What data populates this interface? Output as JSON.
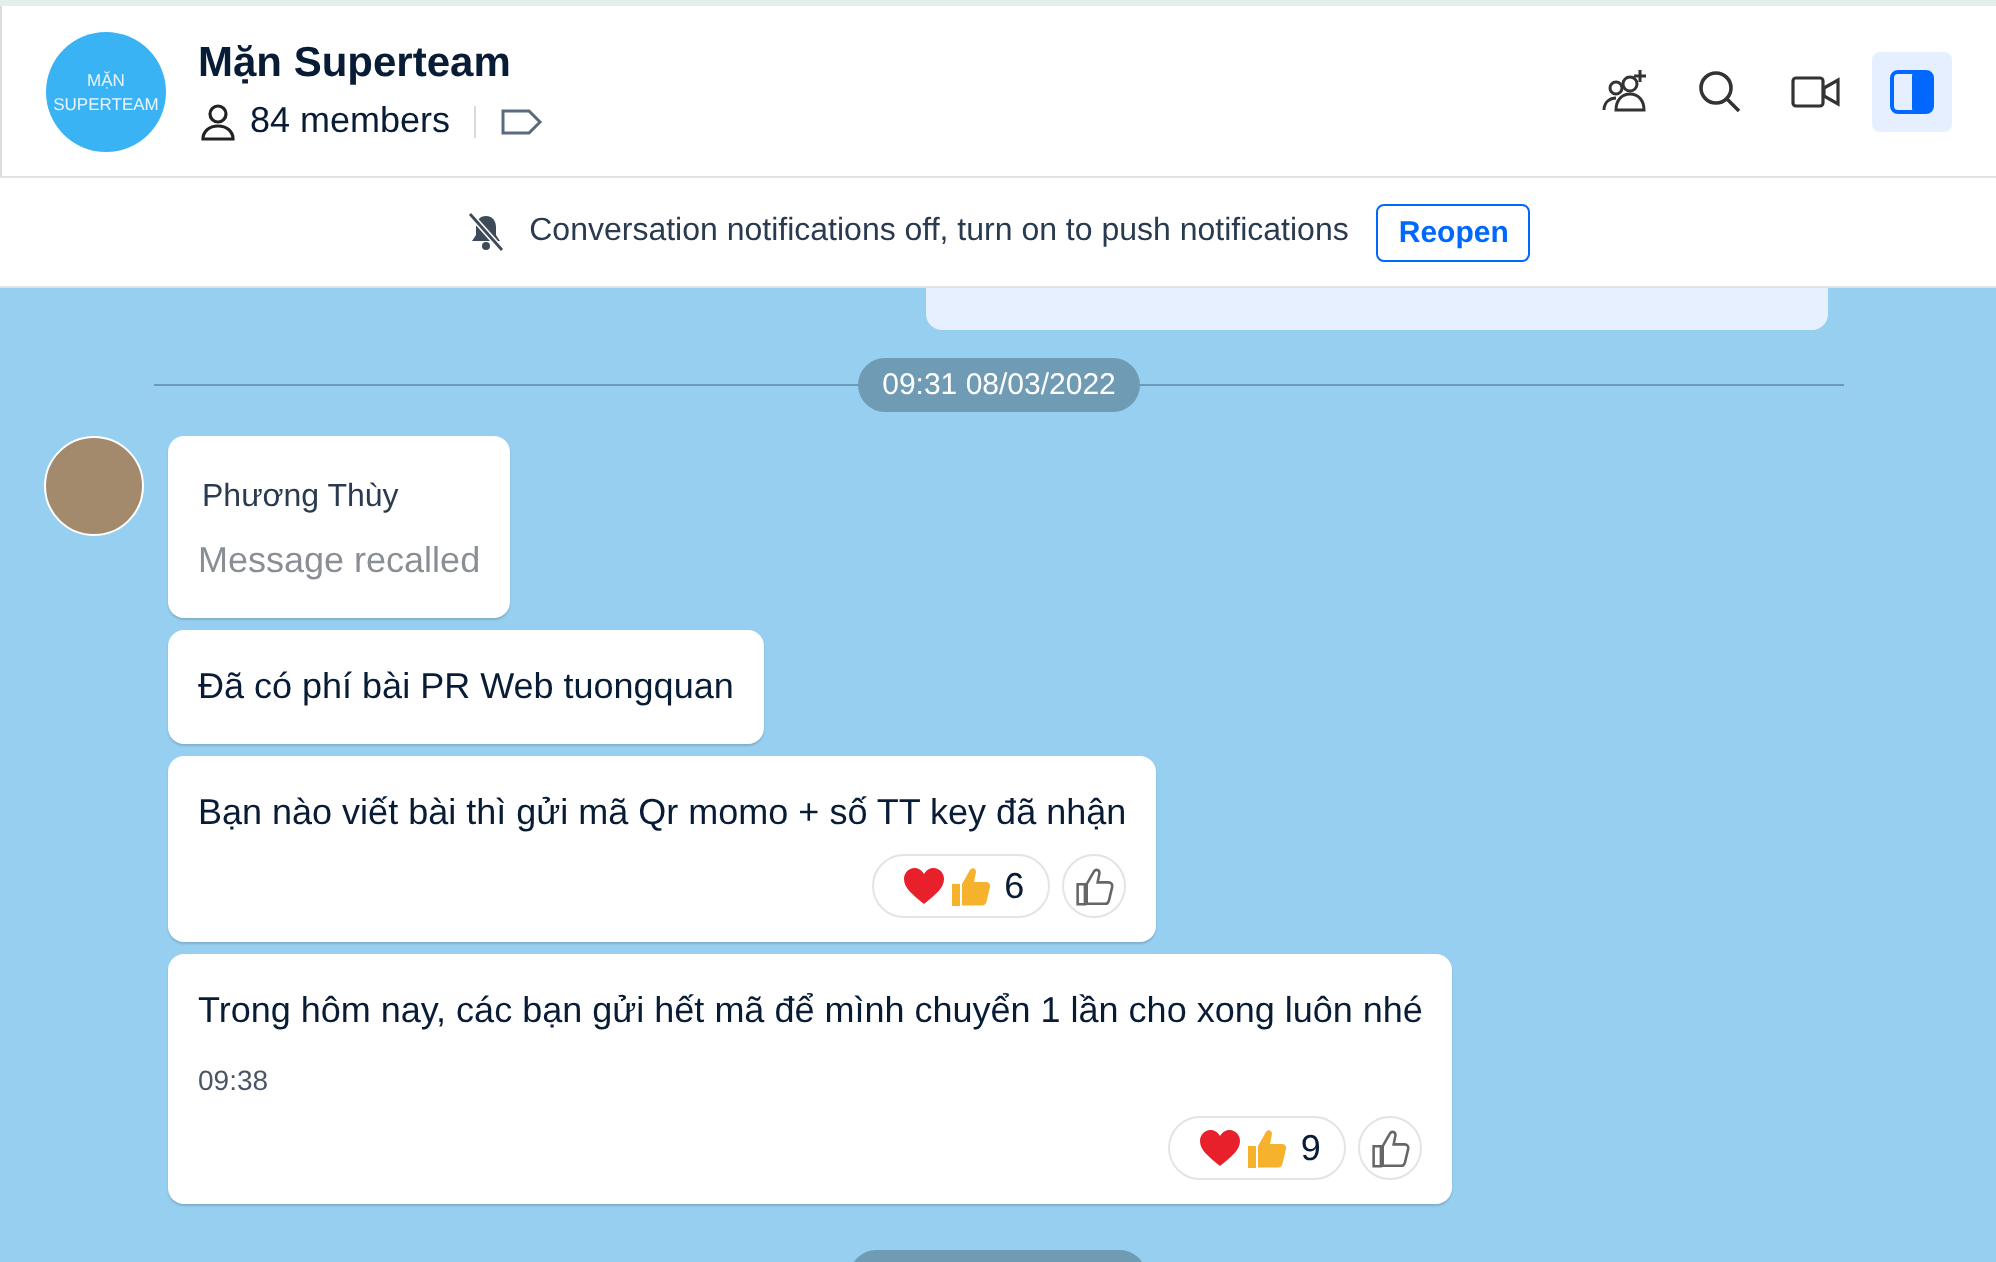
{
  "header": {
    "avatar_text": [
      "MẶN",
      "SUPERTEAM"
    ],
    "title": "Mặn Superteam",
    "members": "84 members",
    "panel_toggle_on": true
  },
  "banner": {
    "text": "Conversation notifications off, turn on to push notifications",
    "button": "Reopen"
  },
  "date_divider": "09:31 08/03/2022",
  "messages": [
    {
      "kind": "recalled",
      "sender": "Phương Thùy",
      "text": "Message recalled"
    },
    {
      "kind": "text",
      "text": "Đã có phí bài PR Web tuongquan"
    },
    {
      "kind": "text",
      "text": "Bạn nào viết bài thì gửi mã Qr momo + số TT key đã nhận",
      "reaction_count": "6"
    },
    {
      "kind": "text",
      "text": "Trong hôm nay, các bạn gửi hết mã để mình chuyển 1 lần cho xong luôn nhé",
      "time": "09:38",
      "reaction_count": "9"
    }
  ]
}
